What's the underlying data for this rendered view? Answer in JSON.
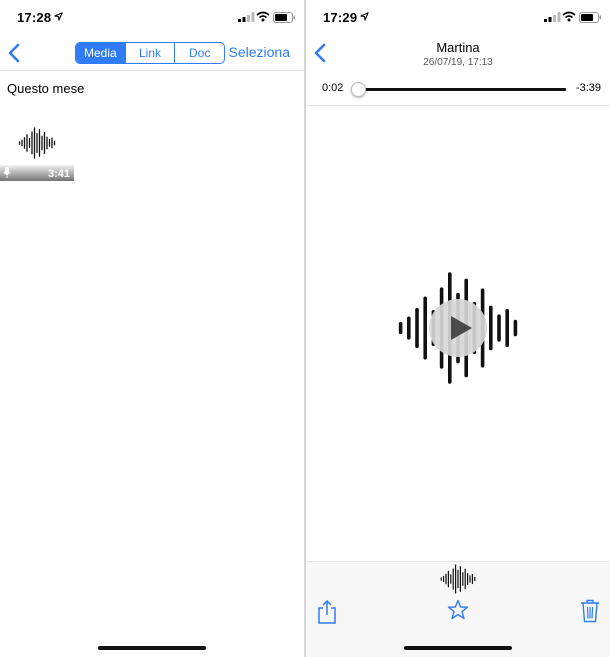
{
  "left": {
    "status": {
      "time": "17:28"
    },
    "tabs": [
      {
        "label": "Media",
        "active": true
      },
      {
        "label": "Link",
        "active": false
      },
      {
        "label": "Doc",
        "active": false
      }
    ],
    "select_label": "Seleziona",
    "section_header": "Questo mese",
    "audio_item": {
      "duration": "3:41"
    }
  },
  "right": {
    "status": {
      "time": "17:29"
    },
    "title": "Martina",
    "subtitle": "26/07/19, 17:13",
    "playback": {
      "elapsed": "0:02",
      "remaining": "-3:39",
      "progress": 0.01
    }
  },
  "colors": {
    "accent": "#2f7cf6",
    "waveform": "#111111"
  },
  "icons": {
    "back": "chevron-left",
    "location": "location-arrow",
    "microphone": "microphone",
    "play": "play-triangle",
    "share": "share",
    "favorite": "star",
    "delete": "trash"
  }
}
